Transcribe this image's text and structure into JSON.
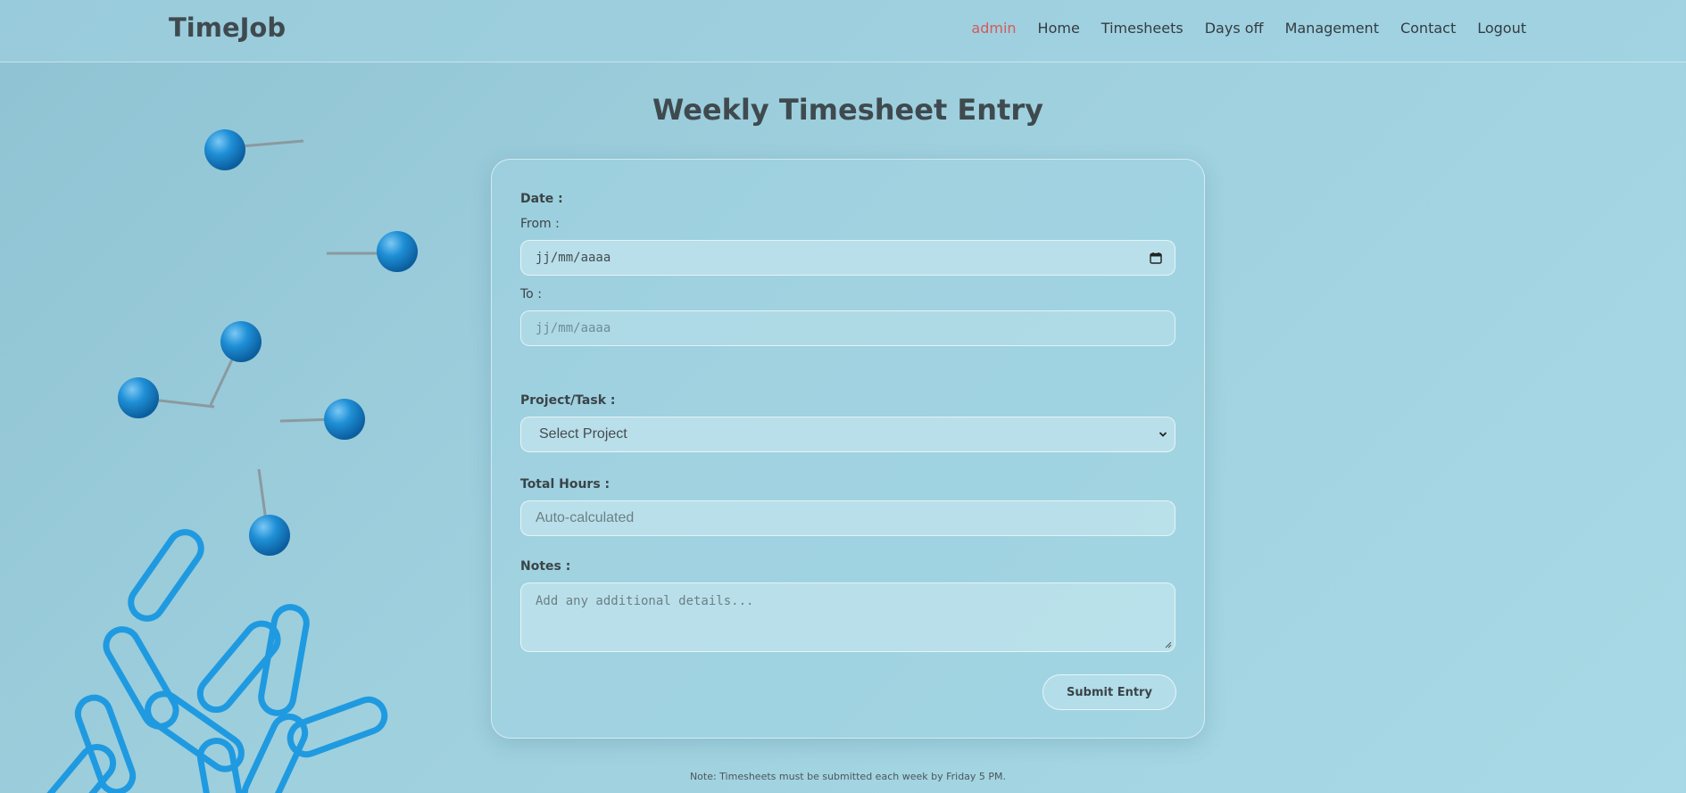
{
  "navbar": {
    "logo": "TimeJob",
    "user": "admin",
    "links": [
      "Home",
      "Timesheets",
      "Days off",
      "Management",
      "Contact",
      "Logout"
    ]
  },
  "page": {
    "title": "Weekly Timesheet Entry"
  },
  "form": {
    "date_label": "Date :",
    "from_label": "From :",
    "from_value": "jj/mm/aaaa",
    "to_label": "To :",
    "to_value": "jj/mm/aaaa",
    "project_label": "Project/Task :",
    "project_selected": "Select Project",
    "hours_label": "Total Hours :",
    "hours_placeholder": "Auto-calculated",
    "notes_label": "Notes :",
    "notes_placeholder": "Add any additional details...",
    "submit_label": "Submit Entry"
  },
  "footer": {
    "note": "Note: Timesheets must be submitted each week by Friday 5 PM."
  },
  "colors": {
    "accent_user": "#d45a5a",
    "pin_blue": "#1f8fd6",
    "text_dark": "#3f4a4f"
  },
  "icons": {
    "date_picker": "calendar-icon",
    "select": "chevron-down-icon"
  }
}
